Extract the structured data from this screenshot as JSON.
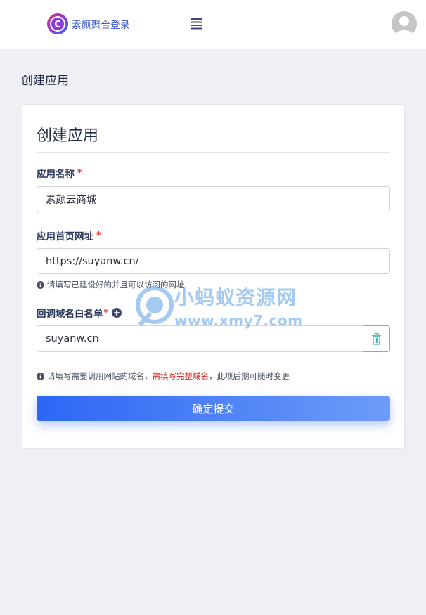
{
  "header": {
    "brand_name": "素颜聚合登录",
    "logo_letter": "C",
    "menu_icon": "hamburger-menu-icon",
    "avatar_icon": "user-avatar-icon"
  },
  "page": {
    "title": "创建应用"
  },
  "form": {
    "title": "创建应用",
    "app_name": {
      "label": "应用名称",
      "required_mark": "*",
      "value": "素颜云商城"
    },
    "homepage": {
      "label": "应用首页网址",
      "required_mark": "*",
      "value": "https://suyanw.cn/",
      "hint": "请填写已建设好的并且可以访问的网址"
    },
    "whitelist": {
      "label": "回调域名白名单",
      "required_mark": "*",
      "add_icon": "plus-circle-icon",
      "value": "suyanw.cn",
      "delete_icon": "trash-icon",
      "hint_prefix": "请填写需要调用网站的域名，",
      "hint_warning": "需填写完整域名",
      "hint_suffix": "，此项后期可随时变更"
    },
    "submit_label": "确定提交"
  },
  "watermark": {
    "title": "小蚂蚁资源网",
    "url": "www.xmy7.com"
  },
  "colors": {
    "accent": "#2c66f5",
    "brand_text": "#3b55c9",
    "required": "#e53a3a",
    "warning_text": "#d8201f",
    "delete_border": "#5bc0c8",
    "page_bg": "#eef0f5"
  }
}
